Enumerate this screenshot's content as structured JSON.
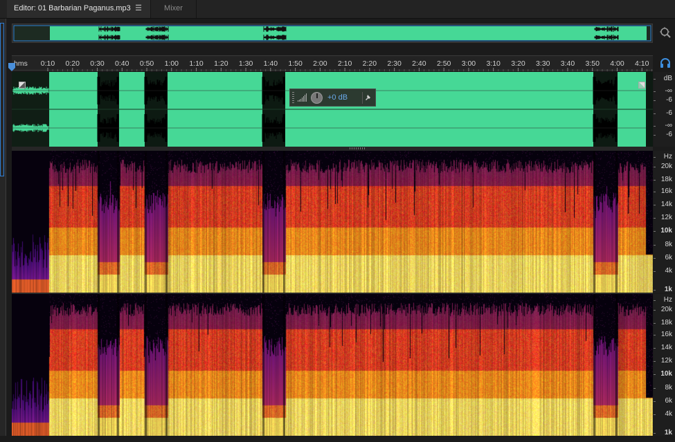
{
  "tabs": {
    "editor_label": "Editor: 01 Barbarian Paganus.mp3",
    "editor_menu_glyph": "☰",
    "mixer_label": "Mixer"
  },
  "icons": {
    "zoom": "zoom-icon",
    "headphones": "headphones-icon",
    "playhead": "playhead-marker-icon",
    "pin": "pin-icon",
    "volume_meter": "volume-meter-icon",
    "volume_knob": "volume-knob-icon"
  },
  "ruler": {
    "unit_label": "hms",
    "labels": [
      "0:10",
      "0:20",
      "0:30",
      "0:40",
      "0:50",
      "1:00",
      "1:10",
      "1:20",
      "1:30",
      "1:40",
      "1:50",
      "2:00",
      "2:10",
      "2:20",
      "2:30",
      "2:40",
      "2:50",
      "3:00",
      "3:10",
      "3:20",
      "3:30",
      "3:40",
      "3:50",
      "4:00",
      "4:10",
      "4:"
    ]
  },
  "hud": {
    "volume_value": "+0 dB"
  },
  "waveform": {
    "color": "#46d896",
    "channels": 2
  },
  "db_scale": {
    "labels": [
      "dB",
      "-∞",
      "-6",
      "-6",
      "-∞",
      "-6"
    ]
  },
  "hz_scale": {
    "labels": [
      "Hz",
      "20k",
      "18k",
      "16k",
      "14k",
      "12k",
      "10k",
      "8k",
      "6k",
      "4k",
      "1k"
    ]
  },
  "colors": {
    "accent": "#2f7fd6",
    "waveform": "#46d896",
    "hud_value": "#69a8e8"
  }
}
